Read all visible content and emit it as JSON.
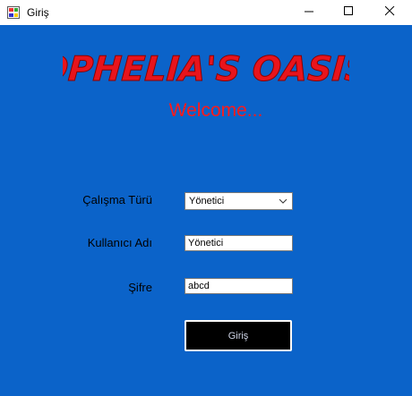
{
  "window": {
    "title": "Giriş",
    "icons": {
      "app": "app-form-icon",
      "minimize": "minimize-icon",
      "maximize": "maximize-icon",
      "close": "close-icon"
    }
  },
  "header": {
    "logo_text": "OPHELIA'S OASIS",
    "welcome": "Welcome..."
  },
  "form": {
    "type_label": "Çalışma Türü",
    "type_value": "Yönetici",
    "user_label": "Kullanıcı Adı",
    "user_value": "Yönetici",
    "pass_label": "Şifre",
    "pass_value": "abcd",
    "login_button": "Giriş"
  },
  "colors": {
    "background": "#0b63c9",
    "logo": "#e8141c",
    "welcome": "#ff1a1a",
    "button": "#000000"
  }
}
